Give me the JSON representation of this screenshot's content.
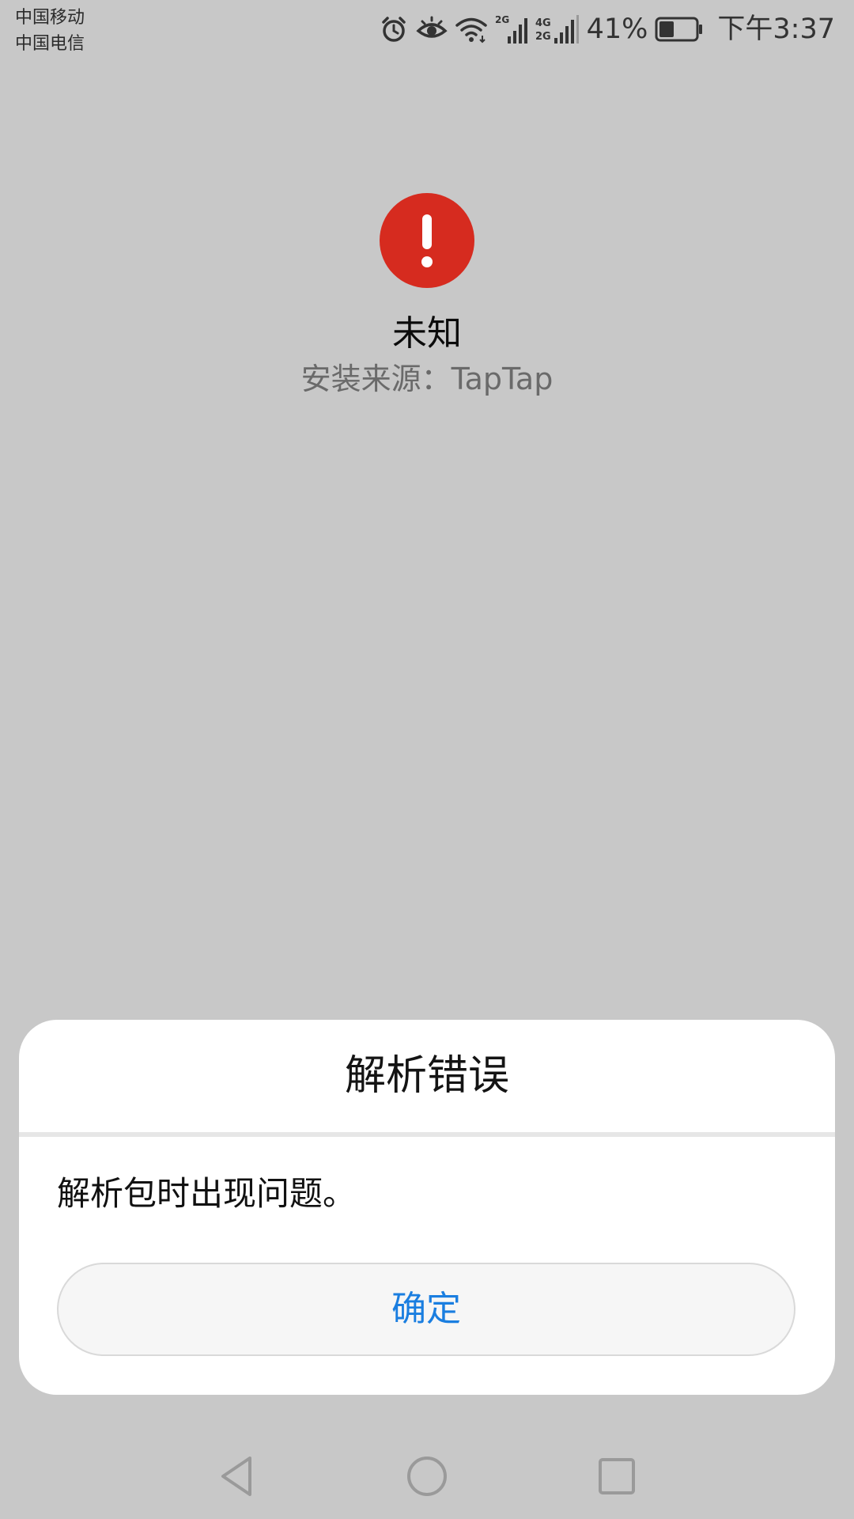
{
  "status_bar": {
    "carrier_1": "中国移动",
    "carrier_2": "中国电信",
    "sim1_network": "2G",
    "sim2_network_top": "4G",
    "sim2_network_bottom": "2G",
    "battery_percent": "41%",
    "battery_level": 0.41,
    "time": "下午3:37",
    "icons": [
      "alarm-icon",
      "eye-comfort-icon",
      "wifi-icon",
      "signal-icon",
      "battery-icon"
    ]
  },
  "app": {
    "name": "未知",
    "source": "安装来源：TapTap",
    "icon": "warning-icon",
    "icon_color": "#d62b1f"
  },
  "dialog": {
    "title": "解析错误",
    "message": "解析包时出现问题。",
    "ok_label": "确定",
    "ok_color": "#1a7ee0"
  },
  "nav_bar": {
    "icons": [
      "back-icon",
      "home-icon",
      "recents-icon"
    ]
  }
}
